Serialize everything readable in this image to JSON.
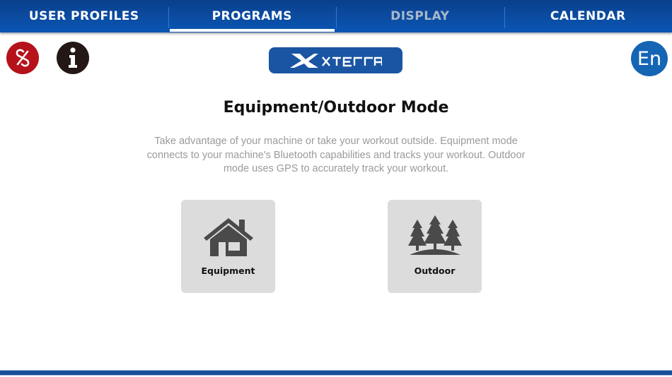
{
  "nav": {
    "tabs": [
      {
        "label": "USER PROFILES",
        "state": "normal"
      },
      {
        "label": "PROGRAMS",
        "state": "active"
      },
      {
        "label": "DISPLAY",
        "state": "disabled"
      },
      {
        "label": "CALENDAR",
        "state": "normal"
      }
    ]
  },
  "header": {
    "unlink_icon": "unlink-icon",
    "info_icon": "info-icon",
    "brand": "XTERRA",
    "language": "En"
  },
  "main": {
    "title": "Equipment/Outdoor Mode",
    "description": "Take advantage of your machine or take your workout outside. Equipment mode connects to your machine's Bluetooth capabilities and tracks your workout. Outdoor mode uses GPS to accurately track your workout.",
    "modes": [
      {
        "label": "Equipment",
        "icon": "house-icon"
      },
      {
        "label": "Outdoor",
        "icon": "trees-icon"
      }
    ]
  },
  "colors": {
    "nav_blue": "#0b4a9e",
    "unlink_red": "#b5121b",
    "info_black": "#231815",
    "lang_blue": "#1565b5",
    "card_gray": "#dcdcdc",
    "icon_gray": "#4a4a4a"
  }
}
